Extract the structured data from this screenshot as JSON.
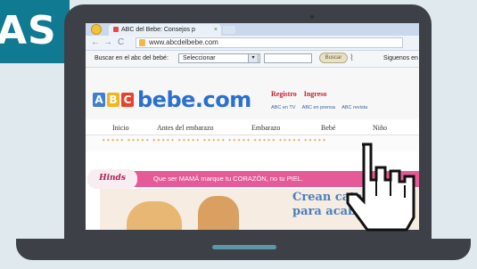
{
  "label": {
    "text": "AS"
  },
  "browser": {
    "tab_title": "ABC del Bebe: Consejos p",
    "url": "www.abcdelbebe.com"
  },
  "toolbar": {
    "search_label": "Buscar en el abc del bebé:",
    "select_value": "Seleccionar",
    "search_button": "Buscar",
    "follow_text": "Siguenos en"
  },
  "site": {
    "brand": "bebe.com",
    "brand_blocks": [
      "A",
      "B",
      "C"
    ],
    "register": "Registro",
    "login": "Ingreso",
    "sublinks": [
      "ABC en TV",
      "ABC en prensa",
      "ABC revista"
    ],
    "nav": [
      "Inicio",
      "Antes del embarazo",
      "Embarazo",
      "Bebé",
      "Niño"
    ],
    "banner_brand": "Hinds",
    "banner_text": "Que ser MAMÁ  marque tu CORAZÓN, no tu PIEL.",
    "headline_1": "Crean cata",
    "headline_2": "para acaba"
  },
  "colors": {
    "teal": "#0f7a91",
    "laptop": "#3d4147",
    "brand_blue": "#2a6fd2",
    "banner_pink": "#e65a97"
  }
}
